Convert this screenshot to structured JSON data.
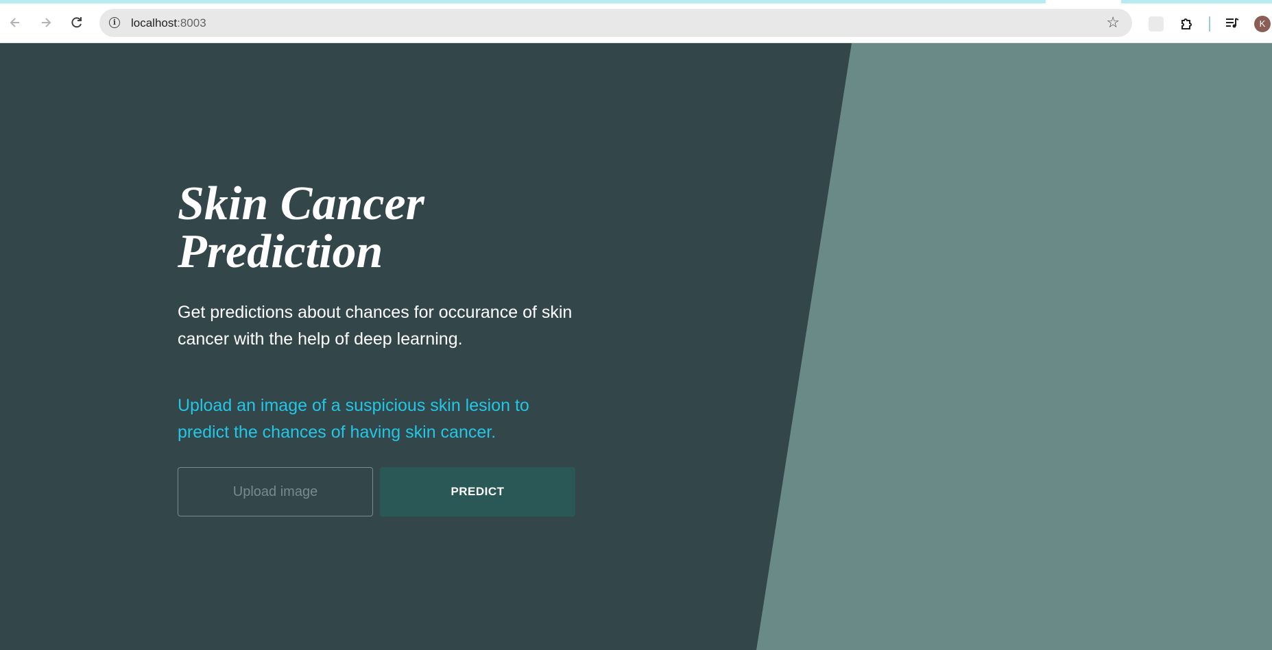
{
  "browser": {
    "url_host": "localhost",
    "url_port": ":8003",
    "avatar_letter": "K",
    "icons": {
      "back": "arrow-left-icon",
      "forward": "arrow-right-icon",
      "reload": "reload-icon",
      "site_info": "info-icon",
      "bookmark": "star-icon",
      "extensions": "puzzle-icon",
      "media": "media-controls-icon"
    }
  },
  "hero": {
    "title": "Skin Cancer Prediction",
    "subtitle": "Get predictions about chances for occurance of skin cancer with the help of deep learning.",
    "cta": "Upload an image of a suspicious skin lesion to predict the chances of having skin cancer."
  },
  "actions": {
    "upload_label": "Upload image",
    "predict_label": "PREDICT"
  },
  "colors": {
    "background": "#33464a",
    "panel": "#6a8a88",
    "accent": "#23c7e6",
    "predict_button": "#2a5856"
  }
}
